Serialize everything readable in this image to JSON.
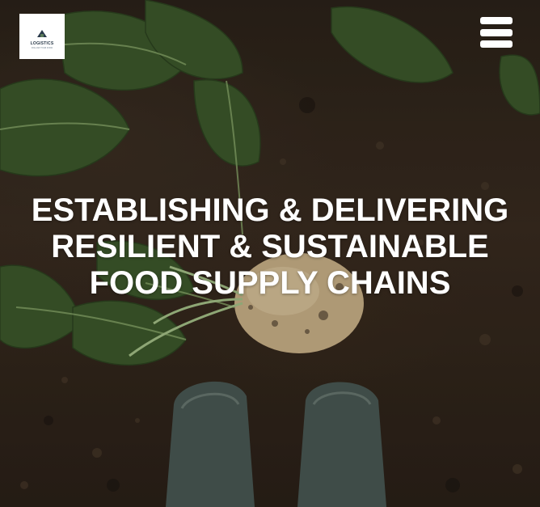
{
  "logo": {
    "name": "LOGISTICS",
    "tagline": "FOLLOW YOUR FOOD"
  },
  "menu": {
    "icon": "hamburger-menu-icon"
  },
  "hero": {
    "headline_lines": [
      "ESTABLISHING & DELIVERING",
      "RESILIENT & SUSTAINABLE",
      "FOOD SUPPLY CHAINS"
    ],
    "image_subject": "beet-in-soil-boots-photo"
  },
  "colors": {
    "text": "#ffffff",
    "soil": "#2c231a",
    "leaf": "#3f5a2a",
    "beet": "#cdb48a",
    "boot": "#4b5a55"
  }
}
